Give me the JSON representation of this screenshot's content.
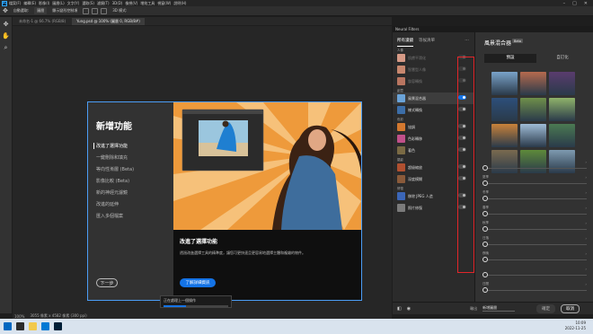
{
  "menubar": {
    "items": [
      "檔案(F)",
      "編輯(E)",
      "影像(I)",
      "圖層(L)",
      "文字(Y)",
      "選取(S)",
      "濾鏡(T)",
      "3D(D)",
      "檢視(V)",
      "增效工具",
      "視窗(W)",
      "說明(H)"
    ],
    "app_logo": "Ps"
  },
  "optionsbar": {
    "items": [
      "自動選取:",
      "圖層",
      "顯示變形控制項",
      "3D 模式:"
    ]
  },
  "doctabs": [
    "未命名-1 @ 66.7% (RGB/8)",
    "Yung.psd @ 100% (圖層 0, RGB/8#)"
  ],
  "whats_new": {
    "title": "新增功能",
    "nav": [
      "改進了選擇功能",
      "一鍵刪除和填充",
      "等向性漸層 (Beta)",
      "影像比較 (Beta)",
      "新的神經元濾鏡",
      "改進的延伸",
      "匯入多個檔案"
    ],
    "next_label": "下一步",
    "body_title": "改進了選擇功能",
    "body_desc": "透過改進選擇工具的精準度，讓您可更快速且更容易地選擇主體和複雜的物件。",
    "learn_label": "了解詳細資訊"
  },
  "progress": {
    "text": "正在處理上一個操作",
    "value": 0.35
  },
  "statusbar": {
    "zoom": "100%",
    "size": "3055 像素 x 4582 像素 (300 ppi)"
  },
  "neural_filters": {
    "header": "Neural Filters",
    "tabs": [
      "所有濾鏡",
      "等候清單"
    ],
    "sections": [
      {
        "name": "人像",
        "rows": [
          {
            "label": "肌膚平滑化",
            "dim": true,
            "toggle": "disabled",
            "thumb": "#d69a86"
          },
          {
            "label": "智慧型人像",
            "dim": true,
            "toggle": "disabled",
            "thumb": "#c8876e"
          },
          {
            "label": "妝容轉換",
            "dim": true,
            "toggle": "disabled",
            "thumb": "#b97560"
          }
        ]
      },
      {
        "name": "創意",
        "rows": [
          {
            "label": "風景混合器",
            "dim": false,
            "toggle": "on",
            "thumb": "#6aa3d8",
            "selected": true
          },
          {
            "label": "樣式轉換",
            "dim": false,
            "toggle": "off",
            "thumb": "#3c6ea8"
          }
        ]
      },
      {
        "name": "色彩",
        "rows": [
          {
            "label": "協調",
            "dim": false,
            "toggle": "off",
            "thumb": "#d3782f"
          },
          {
            "label": "色彩轉移",
            "dim": false,
            "toggle": "off",
            "thumb": "#c0508a"
          },
          {
            "label": "著色",
            "dim": false,
            "toggle": "off",
            "thumb": "#7a6a44"
          }
        ]
      },
      {
        "name": "攝影",
        "rows": [
          {
            "label": "超級縮放",
            "dim": false,
            "toggle": "off",
            "thumb": "#b05030"
          },
          {
            "label": "深度模糊",
            "dim": false,
            "toggle": "off",
            "thumb": "#8a5a3a"
          }
        ]
      },
      {
        "name": "修復",
        "rows": [
          {
            "label": "移除 JPEG 人造",
            "dim": false,
            "toggle": "off",
            "thumb": "#3b66b8"
          },
          {
            "label": "照片修復",
            "dim": false,
            "toggle": "off",
            "thumb": "#7b7b7b"
          }
        ]
      }
    ],
    "output_label": "輸出",
    "output_value": "新增圖層",
    "ok_label": "確定",
    "cancel_label": "取消"
  },
  "landscape_mixer": {
    "title": "風景混合器",
    "beta": "Beta",
    "tabs": [
      "預設",
      "自訂化"
    ],
    "presets": [
      "#7aa3c9",
      "#b56a4e",
      "#5a3c6e",
      "#2d4f7a",
      "#6f8f4a",
      "#8fb36a",
      "#c9823a",
      "#9fbcd6",
      "#4b7a52",
      "#7a6a4f",
      "#5e8a3a",
      "#7e9ab0"
    ],
    "sliders": [
      "",
      "夏季",
      "冬季",
      "春季",
      "秋季",
      "日落",
      "夜晚",
      "",
      "日間"
    ]
  },
  "taskbar": {
    "time": "10:09",
    "date": "2022-11-25",
    "icons": [
      "#0067c0",
      "#2b2b2b",
      "#f2c94c",
      "#0078d4",
      "#001e36"
    ]
  }
}
